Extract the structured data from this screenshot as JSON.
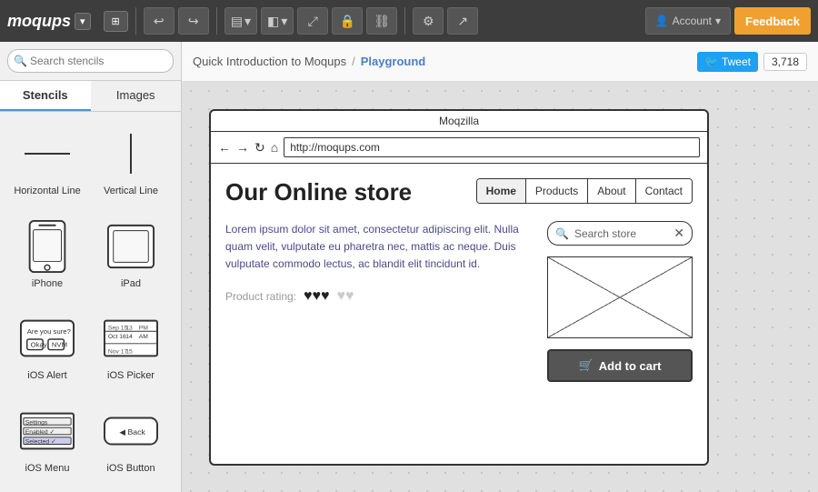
{
  "toolbar": {
    "logo": "moqups",
    "logo_dropdown": "▾",
    "view_icon": "⊞",
    "undo_icon": "↩",
    "redo_icon": "↪",
    "align_icon": "⊟",
    "layers_icon": "◫",
    "resize_icon": "⤢",
    "lock_icon": "🔒",
    "link_icon": "🔗",
    "settings_icon": "⚙",
    "share_icon": "↗",
    "account_icon": "👤",
    "account_label": "Account",
    "feedback_label": "Feedback"
  },
  "breadcrumb": {
    "parent": "Quick Introduction to Moqups",
    "separator": "/",
    "current": "Playground"
  },
  "tweet": {
    "label": "Tweet",
    "count": "3,718"
  },
  "search": {
    "placeholder": "Search stencils"
  },
  "panel_tabs": {
    "stencils": "Stencils",
    "images": "Images"
  },
  "stencils": [
    {
      "id": "horizontal-line",
      "label": "Horizontal Line",
      "type": "hline"
    },
    {
      "id": "vertical-line",
      "label": "Vertical Line",
      "type": "vline"
    },
    {
      "id": "iphone",
      "label": "iPhone",
      "type": "iphone"
    },
    {
      "id": "ipad",
      "label": "iPad",
      "type": "ipad"
    },
    {
      "id": "ios-alert",
      "label": "iOS Alert",
      "type": "ios-alert"
    },
    {
      "id": "ios-picker",
      "label": "iOS Picker",
      "type": "ios-picker"
    },
    {
      "id": "ios-menu",
      "label": "iOS Menu",
      "type": "ios-menu"
    },
    {
      "id": "ios-button",
      "label": "iOS Button",
      "type": "ios-button"
    }
  ],
  "wireframe": {
    "title": "Moqzilla",
    "url": "http://moqups.com",
    "store_title": "Our Online store",
    "nav_tabs": [
      "Home",
      "Products",
      "About",
      "Contact"
    ],
    "active_tab": "Home",
    "lorem": "Lorem ipsum dolor sit amet, consectetur adipiscing elit. Nulla quam velit, vulputate eu pharetra nec, mattis ac neque. Duis vulputate commodo lectus, ac blandit elit tincidunt id.",
    "product_rating_label": "Product rating:",
    "hearts_filled": "♥♥♥",
    "hearts_empty": "♥♥",
    "search_store": "Search store",
    "add_to_cart": "Add to cart",
    "back_label": "Back"
  }
}
